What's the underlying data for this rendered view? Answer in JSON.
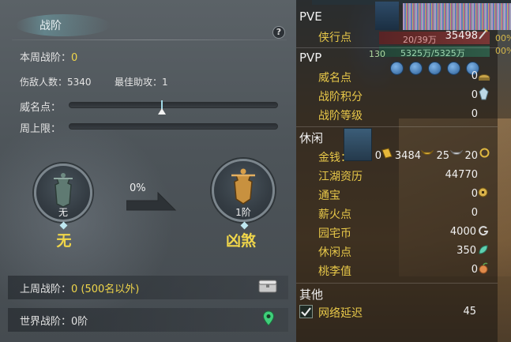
{
  "left_panel": {
    "title": "战阶",
    "help_label": "?",
    "weekly_rank": {
      "label": "本周战阶：",
      "value": "0"
    },
    "kills": {
      "label": "伤敌人数：",
      "value": "5340"
    },
    "best_assist": {
      "label": "最佳助攻：",
      "value": "1"
    },
    "reputation_label": "威名点：",
    "reputation_progress": 0.45,
    "weekly_cap_label": "周上限：",
    "weekly_cap_progress": 0,
    "current_rank": {
      "badge_label": "无",
      "name": "无"
    },
    "next_rank": {
      "badge_label": "1阶",
      "name": "凶煞"
    },
    "progress_percent": "0%",
    "last_week": {
      "label": "上周战阶：",
      "value": "0 (500名以外)"
    },
    "world_rank": {
      "label": "世界战阶：",
      "value": "0阶"
    }
  },
  "right_panel": {
    "hud": {
      "hp_text": "20/39万",
      "mp_text": "5325万/5325万",
      "level_text": "130",
      "pct_top": "00%",
      "pct_bottom": "00%"
    },
    "pve": {
      "header": "PVE",
      "rows": [
        {
          "label": "侠行点",
          "value": "35498"
        }
      ]
    },
    "pvp": {
      "header": "PVP",
      "rows": [
        {
          "label": "威名点",
          "value": "0",
          "icon": "helmet-icon"
        },
        {
          "label": "战阶积分",
          "value": "0",
          "icon": "crystal-icon"
        },
        {
          "label": "战阶等级",
          "value": "0"
        }
      ]
    },
    "leisure": {
      "header": "休闲",
      "money": {
        "label": "金钱：",
        "gold": "0",
        "silver": "3484",
        "copper": "25",
        "bound": "20"
      },
      "rows": [
        {
          "label": "江湖资历",
          "value": "44770"
        },
        {
          "label": "通宝",
          "value": "0",
          "icon": "coin-icon"
        },
        {
          "label": "薪火点",
          "value": "0"
        },
        {
          "label": "园宅币",
          "value": "4000",
          "icon": "g-coin-icon"
        },
        {
          "label": "休闲点",
          "value": "350",
          "icon": "leaf-icon"
        },
        {
          "label": "桃李值",
          "value": "0",
          "icon": "peach-icon"
        }
      ]
    },
    "other": {
      "header": "其他",
      "latency": {
        "label": "网络延迟",
        "value": "45",
        "checked": true
      }
    }
  },
  "colors": {
    "accent_yellow": "#f0d64a",
    "label_gold": "#e8c849",
    "panel_left": "#4d5459"
  }
}
